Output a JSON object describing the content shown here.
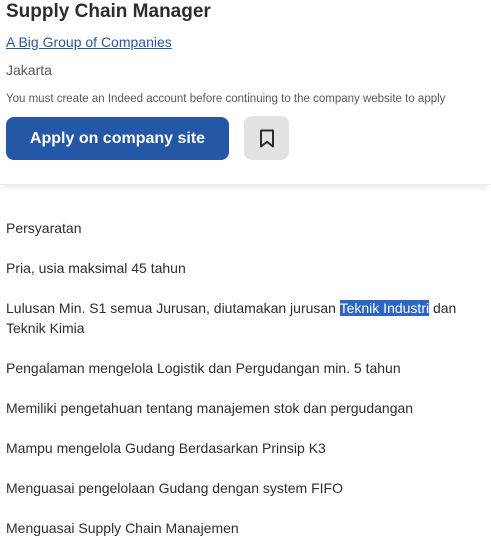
{
  "job": {
    "title": "Supply Chain Manager",
    "company": "A Big Group of Companies",
    "location": "Jakarta",
    "notice": "You must create an Indeed account before continuing to the company website to apply"
  },
  "actions": {
    "apply_label": "Apply on company site",
    "save_icon": "bookmark-icon"
  },
  "colors": {
    "primary": "#2557a7",
    "save_bg": "#e4e2e0",
    "selection": "#2b66c4"
  },
  "description": {
    "heading": "Persyaratan",
    "items": [
      "Pria, usia maksimal 45 tahun",
      {
        "before": "Lulusan Min. S1 semua Jurusan, diutamakan jurusan ",
        "selected": "Teknik Industri",
        "after": " dan Teknik Kimia"
      },
      "Pengalaman mengelola Logistik dan Pergudangan min. 5 tahun",
      "Memiliki pengetahuan tentang manajemen stok dan pergudangan",
      "Mampu mengelola Gudang Berdasarkan Prinsip K3",
      "Menguasai pengelolaan Gudang dengan system FIFO",
      "Menguasai Supply Chain Manajemen"
    ]
  }
}
